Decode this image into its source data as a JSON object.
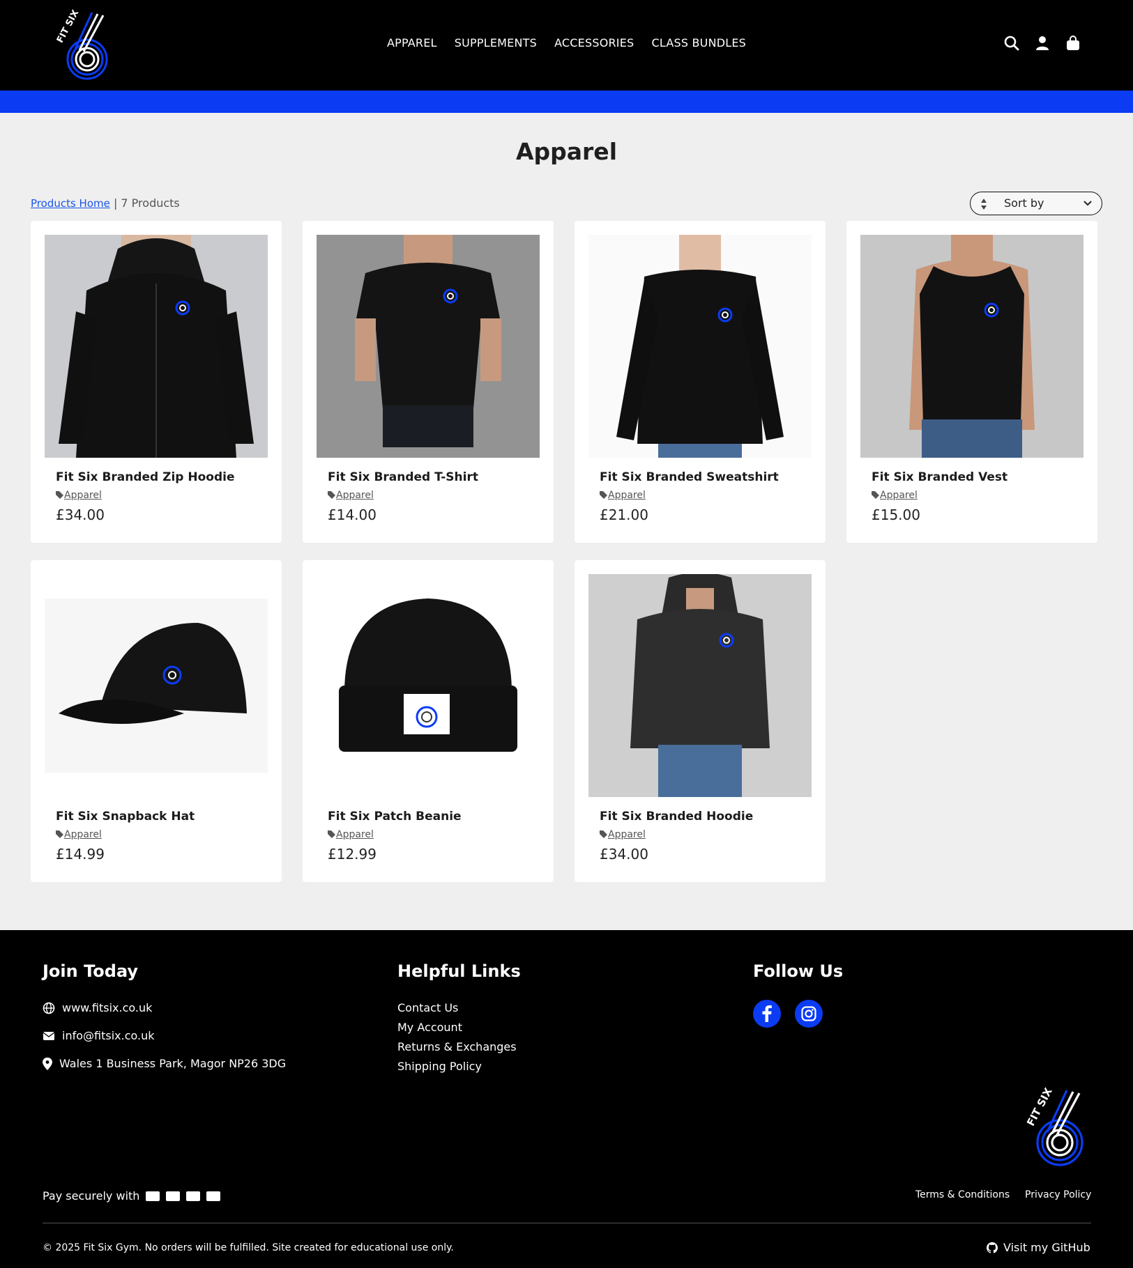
{
  "header": {
    "logo_text": "FIT SIX",
    "nav": [
      "APPAREL",
      "SUPPLEMENTS",
      "ACCESSORIES",
      "CLASS BUNDLES"
    ]
  },
  "main": {
    "title": "Apparel",
    "breadcrumb_link": "Products Home",
    "product_count": "| 7 Products",
    "sort_label": "Sort by"
  },
  "products": [
    {
      "name": "Fit Six Branded Zip Hoodie",
      "category": "Apparel",
      "price": "£34.00"
    },
    {
      "name": "Fit Six Branded T-Shirt",
      "category": "Apparel",
      "price": "£14.00"
    },
    {
      "name": "Fit Six Branded Sweatshirt",
      "category": "Apparel",
      "price": "£21.00"
    },
    {
      "name": "Fit Six Branded Vest",
      "category": "Apparel",
      "price": "£15.00"
    },
    {
      "name": "Fit Six Snapback Hat",
      "category": "Apparel",
      "price": "£14.99"
    },
    {
      "name": "Fit Six Patch Beanie",
      "category": "Apparel",
      "price": "£12.99"
    },
    {
      "name": "Fit Six Branded Hoodie",
      "category": "Apparel",
      "price": "£34.00"
    }
  ],
  "footer": {
    "join_title": "Join Today",
    "website": "www.fitsix.co.uk",
    "email": "info@fitsix.co.uk",
    "address": "Wales 1 Business Park, Magor NP26 3DG",
    "links_title": "Helpful Links",
    "links": [
      "Contact Us",
      "My Account",
      "Returns & Exchanges",
      "Shipping Policy"
    ],
    "follow_title": "Follow Us",
    "pay_label": "Pay securely with",
    "terms": "Terms & Conditions",
    "privacy": "Privacy Policy",
    "copyright": "© 2025 Fit Six Gym. No orders will be fulfilled. Site created for educational use only.",
    "github": "Visit my GitHub"
  },
  "colors": {
    "brand_blue": "#0b3cf4",
    "header_bg": "#000000",
    "page_bg": "#efefef"
  },
  "icons": [
    "search-icon",
    "account-icon",
    "bag-icon",
    "globe-icon",
    "mail-icon",
    "pin-icon",
    "facebook-icon",
    "instagram-icon",
    "github-icon",
    "tag-icon"
  ]
}
